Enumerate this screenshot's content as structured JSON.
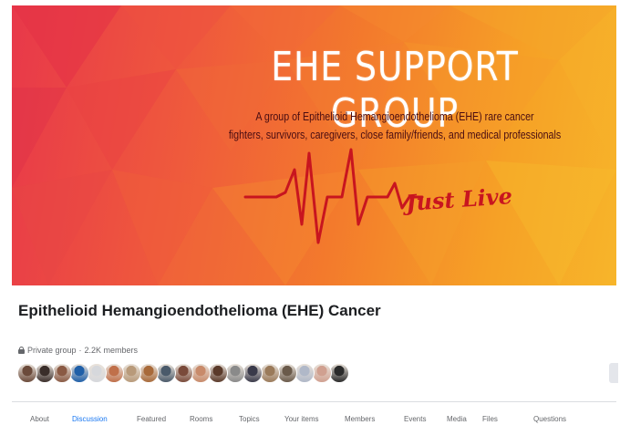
{
  "cover": {
    "title": "EHE SUPPORT GROUP",
    "subtitle_line1": "A group of Epithelioid Hemangioendothelioma (EHE) rare cancer",
    "subtitle_line2": "fighters, survivors, caregivers, close family/friends, and medical professionals",
    "tagline": "Just Live"
  },
  "group": {
    "name": "Epithelioid Hemangioendothelioma (EHE) Cancer",
    "privacy": "Private group",
    "separator": " · ",
    "members": "2.2K members"
  },
  "avatars": [
    {
      "name": "member-1",
      "color": "#6b4a3a"
    },
    {
      "name": "member-2",
      "color": "#3a2e2a"
    },
    {
      "name": "member-3",
      "color": "#8a5a44"
    },
    {
      "name": "member-4",
      "color": "#1f5fa8"
    },
    {
      "name": "member-5",
      "color": "#d6d8dc"
    },
    {
      "name": "member-6",
      "color": "#c0704a"
    },
    {
      "name": "member-7",
      "color": "#b89a7a"
    },
    {
      "name": "member-8",
      "color": "#a86a3a"
    },
    {
      "name": "member-9",
      "color": "#4a5a6a"
    },
    {
      "name": "member-10",
      "color": "#7a4a3a"
    },
    {
      "name": "member-11",
      "color": "#c88a6a"
    },
    {
      "name": "member-12",
      "color": "#5a3a2a"
    },
    {
      "name": "member-13",
      "color": "#8a8a8a"
    },
    {
      "name": "member-14",
      "color": "#3a3a4a"
    },
    {
      "name": "member-15",
      "color": "#9a7a5a"
    },
    {
      "name": "member-16",
      "color": "#6a5a4a"
    },
    {
      "name": "member-17",
      "color": "#b0b8c8"
    },
    {
      "name": "member-18",
      "color": "#d0a090"
    },
    {
      "name": "member-19",
      "color": "#2a2a2a"
    }
  ],
  "tabs": [
    {
      "label": "About",
      "active": false
    },
    {
      "label": "Discussion",
      "active": true
    },
    {
      "label": "Featured",
      "active": false
    },
    {
      "label": "Rooms",
      "active": false
    },
    {
      "label": "Topics",
      "active": false
    },
    {
      "label": "Your items",
      "active": false
    },
    {
      "label": "Members",
      "active": false
    },
    {
      "label": "Events",
      "active": false
    },
    {
      "label": "Media",
      "active": false
    },
    {
      "label": "Files",
      "active": false
    },
    {
      "label": "Questions",
      "active": false
    }
  ],
  "colors": {
    "active_tab": "#1877f2",
    "pulse_line": "#c8151f"
  }
}
